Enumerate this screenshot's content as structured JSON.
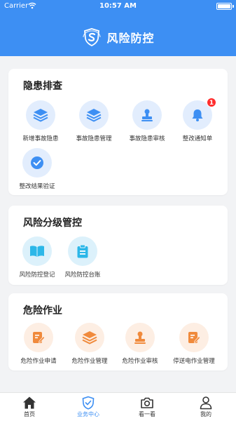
{
  "status_bar": {
    "carrier": "Carrier",
    "time": "10:57 AM"
  },
  "header": {
    "title": "风险防控"
  },
  "sections": {
    "hazard": {
      "title": "隐患排查",
      "items": [
        {
          "label": "新增事故隐患",
          "icon": "layers-icon"
        },
        {
          "label": "事故隐患管理",
          "icon": "layers-icon"
        },
        {
          "label": "事故隐患审核",
          "icon": "stamp-icon"
        },
        {
          "label": "整改通知单",
          "icon": "bell-icon",
          "badge": "1"
        },
        {
          "label": "整改结果验证",
          "icon": "check-icon"
        }
      ]
    },
    "risk": {
      "title": "风险分级管控",
      "items": [
        {
          "label": "风险防控登记",
          "icon": "book-icon"
        },
        {
          "label": "风险防控台账",
          "icon": "clipboard-icon"
        }
      ]
    },
    "danger": {
      "title": "危险作业",
      "items": [
        {
          "label": "危险作业申请",
          "icon": "edit-doc-icon"
        },
        {
          "label": "危险作业管理",
          "icon": "layers-icon"
        },
        {
          "label": "危险作业审核",
          "icon": "stamp-icon"
        },
        {
          "label": "停送电作业管理",
          "icon": "edit-doc-icon"
        }
      ]
    }
  },
  "tabbar": {
    "tabs": [
      {
        "label": "首页",
        "icon": "home-icon"
      },
      {
        "label": "业务中心",
        "icon": "shield-icon",
        "active": true
      },
      {
        "label": "看一看",
        "icon": "camera-icon"
      },
      {
        "label": "我的",
        "icon": "person-icon"
      }
    ]
  },
  "colors": {
    "primary": "#3d8ff3",
    "cyan": "#2cb7e8",
    "orange": "#f08a3c",
    "badge": "#ff2d2d"
  }
}
